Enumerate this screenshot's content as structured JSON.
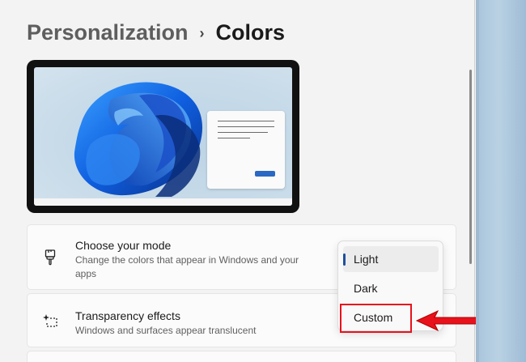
{
  "breadcrumb": {
    "parent": "Personalization",
    "separator": "›",
    "current": "Colors"
  },
  "preview": {
    "wallpaper_icon": "windows-11-bloom-icon",
    "accent_color": "#2a68c4"
  },
  "settings": {
    "mode": {
      "icon": "paintbrush-icon",
      "title": "Choose your mode",
      "description": "Change the colors that appear in Windows and your apps"
    },
    "transparency": {
      "icon": "sparkle-selection-icon",
      "title": "Transparency effects",
      "description": "Windows and surfaces appear translucent"
    }
  },
  "mode_menu": {
    "options": [
      "Light",
      "Dark",
      "Custom"
    ],
    "selected": "Light",
    "highlighted": "Custom"
  },
  "annotation": {
    "color": "#e8121c",
    "arrow_icon": "red-arrow-icon"
  }
}
